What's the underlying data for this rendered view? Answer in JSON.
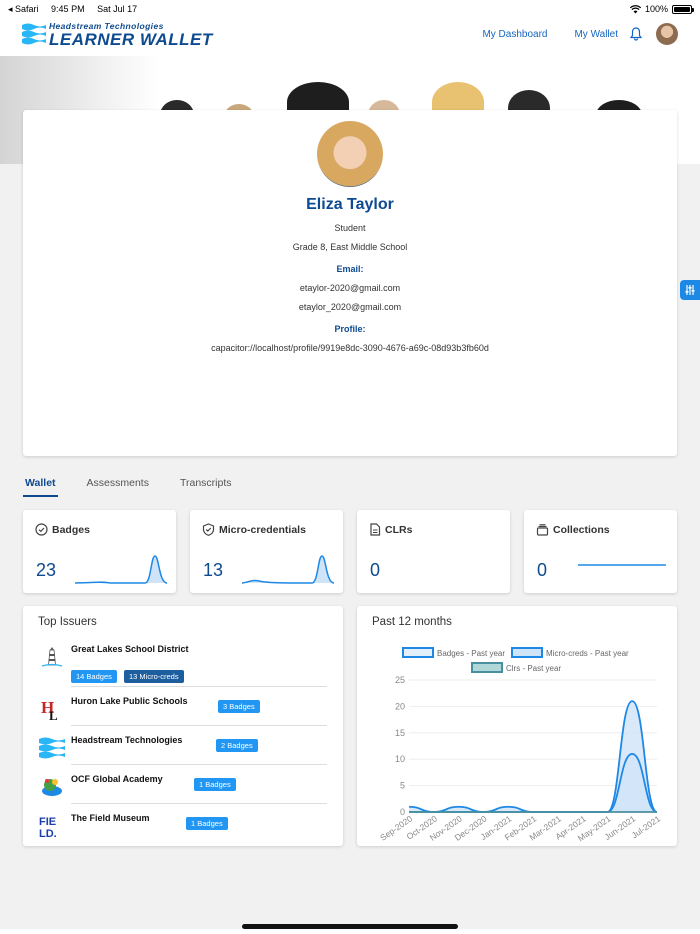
{
  "status_bar": {
    "carrier": "◂ Safari",
    "time": "9:45 PM",
    "date": "Sat Jul 17",
    "battery": "100%"
  },
  "header": {
    "brand_top": "Headstream Technologies",
    "brand_bottom": "LEARNER WALLET",
    "nav": [
      {
        "label": "My Dashboard"
      },
      {
        "label": "My Wallet"
      }
    ]
  },
  "profile": {
    "name": "Eliza Taylor",
    "role": "Student",
    "grade": "Grade 8, East Middle School",
    "email_label": "Email:",
    "emails": [
      "etaylor-2020@gmail.com",
      "etaylor_2020@gmail.com"
    ],
    "profile_label": "Profile:",
    "profile_url": "capacitor://localhost/profile/9919e8dc-3090-4676-a69c-08d93b3fb60d"
  },
  "tabs": [
    {
      "label": "Wallet",
      "active": true
    },
    {
      "label": "Assessments"
    },
    {
      "label": "Transcripts"
    }
  ],
  "stats": [
    {
      "label": "Badges",
      "value": "23",
      "icon": "check-badge-icon"
    },
    {
      "label": "Micro-credentials",
      "value": "13",
      "icon": "shield-check-icon"
    },
    {
      "label": "CLRs",
      "value": "0",
      "icon": "document-icon"
    },
    {
      "label": "Collections",
      "value": "0",
      "icon": "folder-stack-icon"
    }
  ],
  "issuers": {
    "title": "Top Issuers",
    "items": [
      {
        "name": "Great Lakes School District",
        "badges": "14 Badges",
        "micro": "13 Micro-creds"
      },
      {
        "name": "Huron Lake Public Schools",
        "badges": "3 Badges"
      },
      {
        "name": "Headstream Technologies",
        "badges": "2 Badges"
      },
      {
        "name": "OCF Global Academy",
        "badges": "1 Badges"
      },
      {
        "name": "The Field Museum",
        "badges": "1 Badges",
        "logo_text": "FIELD."
      }
    ]
  },
  "chart_data": {
    "type": "area",
    "title": "Past 12 months",
    "categories": [
      "Sep-2020",
      "Oct-2020",
      "Nov-2020",
      "Dec-2020",
      "Jan-2021",
      "Feb-2021",
      "Mar-2021",
      "Apr-2021",
      "May-2021",
      "Jun-2021",
      "Jul-2021"
    ],
    "series": [
      {
        "name": "Badges - Past year",
        "values": [
          1,
          0,
          1,
          0,
          1,
          0,
          0,
          0,
          0,
          21,
          0
        ]
      },
      {
        "name": "Micro-creds - Past year",
        "values": [
          0,
          0,
          0,
          0,
          0,
          0,
          0,
          0,
          0,
          11,
          0
        ]
      },
      {
        "name": "Clrs - Past year",
        "values": [
          0,
          0,
          0,
          0,
          0,
          0,
          0,
          0,
          0,
          0,
          0
        ]
      }
    ],
    "yticks": [
      "0",
      "5",
      "10",
      "15",
      "20",
      "25"
    ],
    "ylim": [
      0,
      25
    ],
    "legend": "top",
    "colors": {
      "line": "#1e88e5",
      "fill": "#cfe4f8",
      "clrs": "#b0d8d8"
    }
  }
}
